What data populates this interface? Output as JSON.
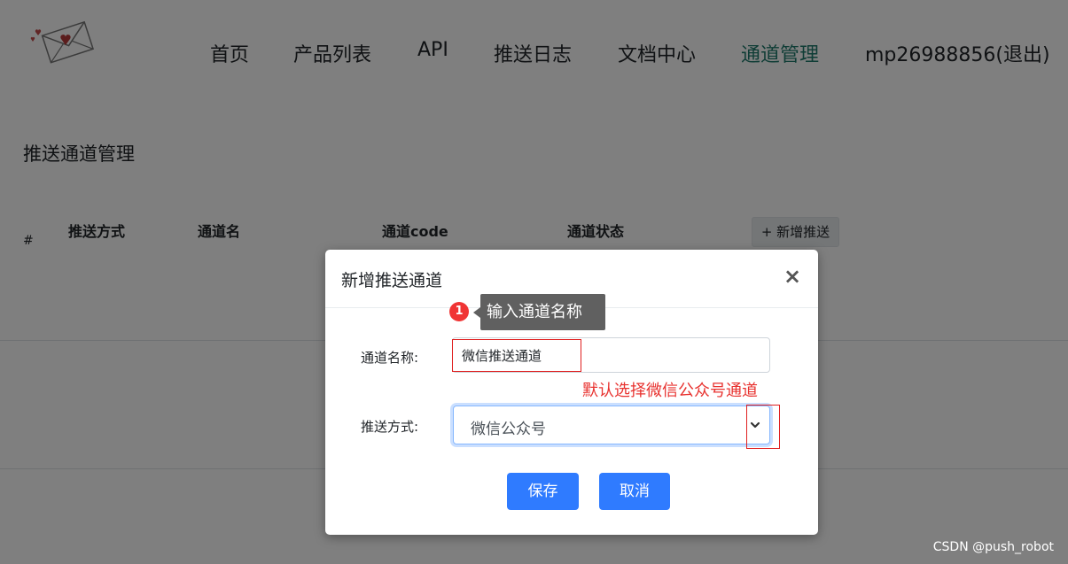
{
  "nav": {
    "items": [
      {
        "label": "首页",
        "active": false
      },
      {
        "label": "产品列表",
        "active": false
      },
      {
        "label": "API",
        "active": false
      },
      {
        "label": "推送日志",
        "active": false
      },
      {
        "label": "文档中心",
        "active": false
      },
      {
        "label": "通道管理",
        "active": true
      },
      {
        "label": "mp26988856(退出)",
        "active": false
      }
    ],
    "active_color": "#1f7a6c"
  },
  "section": {
    "title": "推送通道管理"
  },
  "table": {
    "headers": [
      "#",
      "推送方式",
      "通道名",
      "通道code",
      "通道状态"
    ],
    "add_button": "+ 新增推送"
  },
  "modal": {
    "title": "新增推送通道",
    "close_icon": "close-icon",
    "name_label": "通道名称:",
    "name_value": "微信推送通道",
    "method_label": "推送方式:",
    "method_value": "微信公众号",
    "save_label": "保存",
    "cancel_label": "取消",
    "primary_color": "#2f7bff"
  },
  "annotations": {
    "badge_number": "1",
    "tooltip": "输入通道名称",
    "note": "默认选择微信公众号通道",
    "note_color": "#e8322f"
  },
  "watermark": "CSDN @push_robot"
}
